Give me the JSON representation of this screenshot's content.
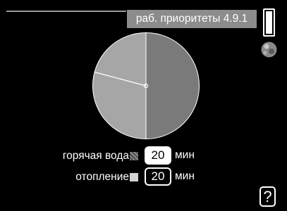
{
  "header": {
    "title": "раб. приоритеты 4.9.1"
  },
  "icons": {
    "scrollbar": "scrollbar-icon",
    "status": "globe-icon",
    "help": "help-icon"
  },
  "chart_data": {
    "type": "pie",
    "slices": [
      {
        "label": "горячая вода",
        "minutes": 20,
        "color": "#a6a6a6"
      },
      {
        "label": "отопление",
        "minutes": 20,
        "color": "#7a7a7a"
      }
    ],
    "total_minutes": 40,
    "clock_hand_hours": 9.5
  },
  "rows": [
    {
      "label": "горячая вода",
      "value": "20",
      "unit": "мин",
      "swatch_color": "#6a6a6a"
    },
    {
      "label": "отопление",
      "value": "20",
      "unit": "мин",
      "swatch_color": "#d4d4d4"
    }
  ],
  "help": {
    "label": "?"
  },
  "colors": {
    "background": "#000000",
    "header_tab": "#8c8c8c",
    "pie_light": "#a6a6a6",
    "pie_dark": "#7a7a7a"
  }
}
